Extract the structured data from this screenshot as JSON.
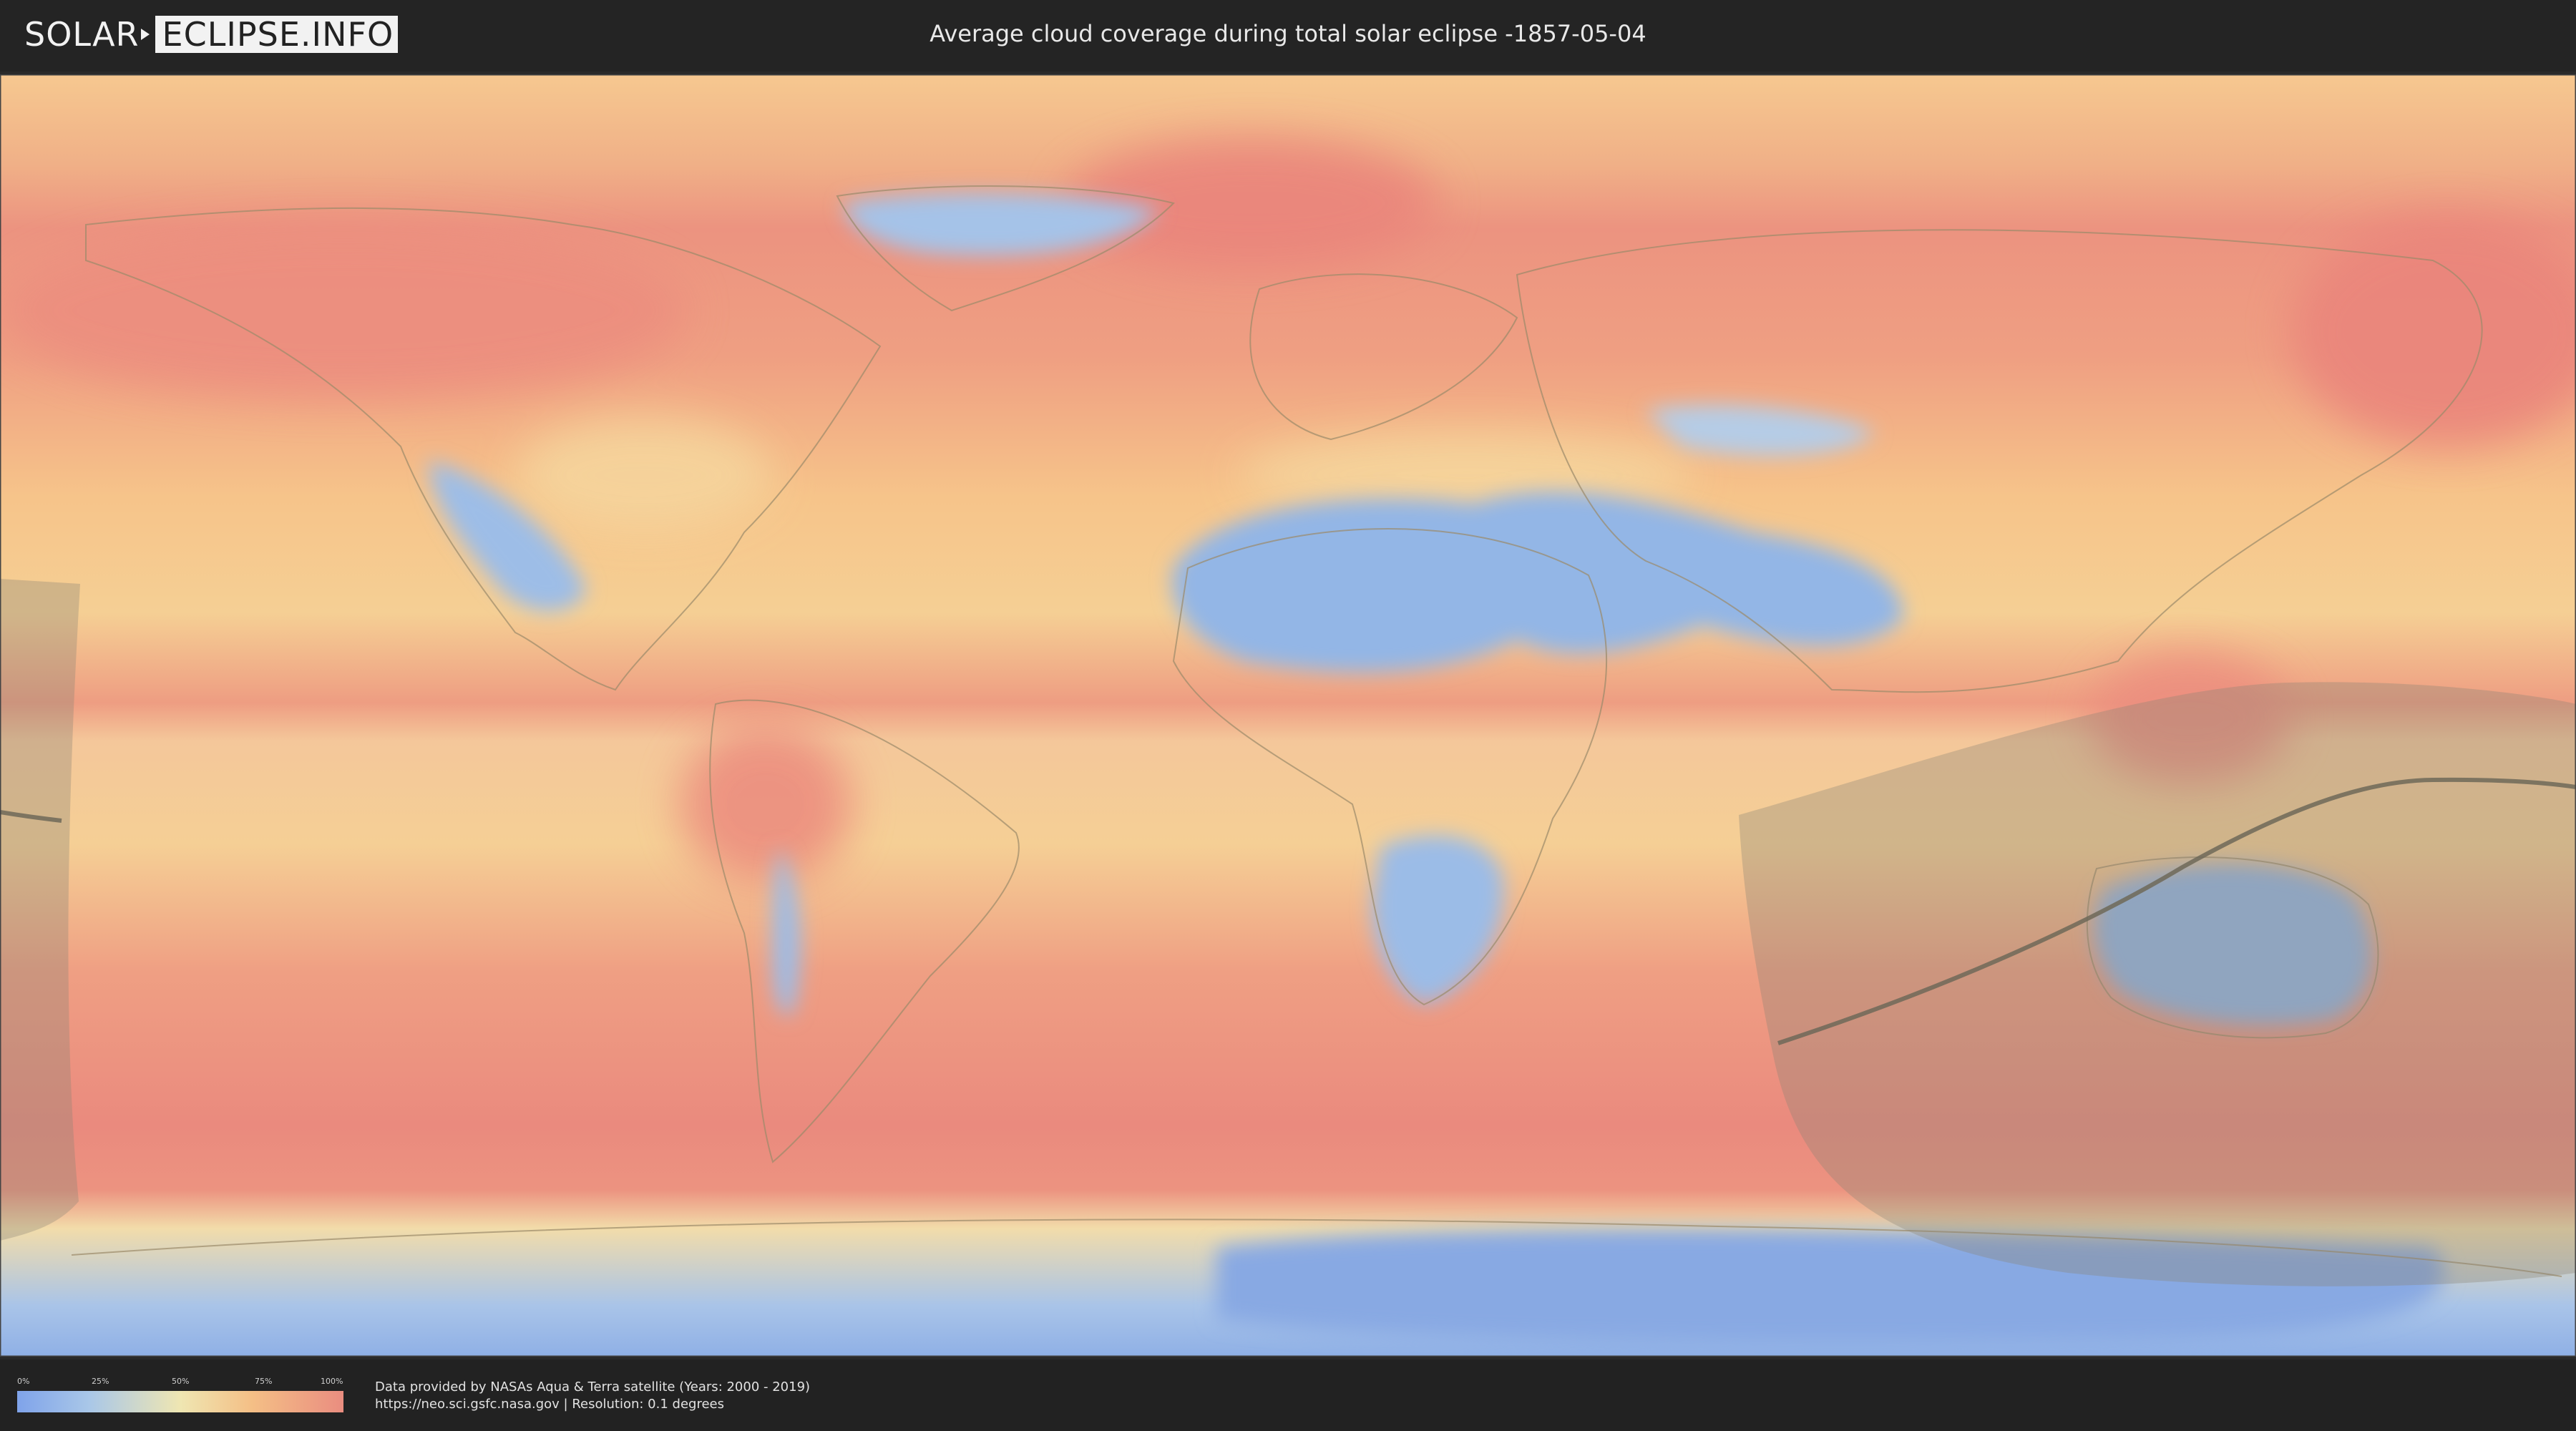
{
  "header": {
    "logo_left": "SOLAR",
    "logo_right": "ECLIPSE.INFO",
    "title": "Average cloud coverage during total solar eclipse -1857-05-04"
  },
  "legend": {
    "ticks": [
      "0%",
      "25%",
      "50%",
      "75%",
      "100%"
    ],
    "colors": [
      "#7fa3ea",
      "#a9c7e8",
      "#efe6b2",
      "#f4bf86",
      "#ea8d80"
    ]
  },
  "footer": {
    "credit_line1": "Data provided by NASAs Aqua & Terra satellite (Years: 2000 - 2019)",
    "credit_line2": "https://neo.sci.gsfc.nasa.gov | Resolution: 0.1 degrees"
  },
  "map": {
    "colors": {
      "ocean_cloudy": "#ec8a7c",
      "mid": "#f4c28a",
      "dry": "#8fb3e6",
      "shadow": "#8a8574"
    }
  }
}
